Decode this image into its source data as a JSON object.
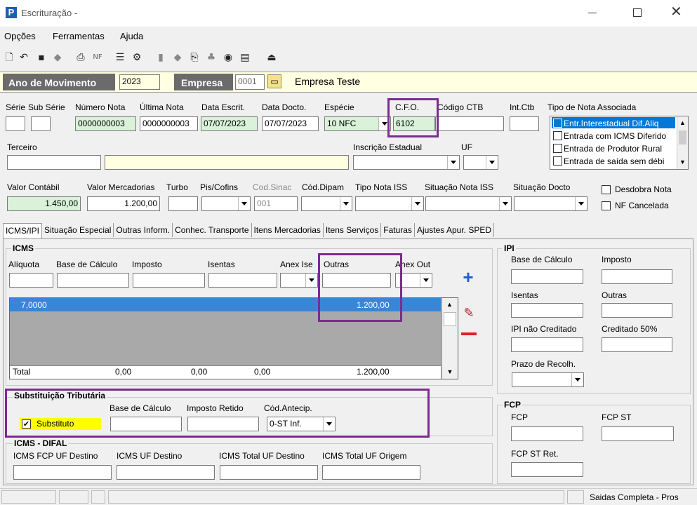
{
  "window": {
    "title": "Escrituração -",
    "app_icon": "P"
  },
  "menu": [
    "Opções",
    "Ferramentas",
    "Ajuda"
  ],
  "header": {
    "ano_label": "Ano de Movimento",
    "ano_value": "2023",
    "empresa_label": "Empresa",
    "empresa_code": "0001",
    "empresa_name": "Empresa Teste"
  },
  "nota": {
    "labels": {
      "serie": "Série",
      "subserie": "Sub Série",
      "numero": "Número Nota",
      "ultima": "Última Nota",
      "data_escrit": "Data Escrit.",
      "data_docto": "Data Docto.",
      "especie": "Espécie",
      "cfo": "C.F.O.",
      "codigo_ctb": "Código CTB",
      "int_ctb": "Int.Ctb",
      "tipo_nota": "Tipo de Nota Associada"
    },
    "numero": "0000000003",
    "ultima": "0000000003",
    "data_escrit": "07/07/2023",
    "data_docto": "07/07/2023",
    "especie": "10  NFC",
    "cfo": "6102",
    "tipo_nota_items": [
      "Entr.Interestadual Dif.Aliq",
      "Entrada com ICMS Diferido",
      "Entrada de Produtor Rural",
      "Entrada de saída sem débi"
    ]
  },
  "terceiro": {
    "label": "Terceiro",
    "ie_label": "Inscrição Estadual",
    "uf_label": "UF"
  },
  "valores": {
    "labels": {
      "contabil": "Valor Contábil",
      "mercadorias": "Valor Mercadorias",
      "turbo": "Turbo",
      "piscofins": "Pis/Cofins",
      "codsinac": "Cod.Sinac",
      "coddipam": "Cód.Dipam",
      "tiponotaiss": "Tipo Nota ISS",
      "situacaoiss": "Situação Nota ISS",
      "situacaodocto": "Situação Docto"
    },
    "contabil": "1.450,00",
    "mercadorias": "1.200,00",
    "codsinac": "001",
    "desdobra": "Desdobra Nota",
    "nf_cancelada": "NF Cancelada"
  },
  "tabs": [
    "ICMS/IPI",
    "Situação Especial",
    "Outras Inform.",
    "Conhec. Transporte",
    "Itens Mercadorias",
    "Itens Serviços",
    "Faturas",
    "Ajustes Apur. SPED"
  ],
  "icms": {
    "title": "ICMS",
    "cols": [
      "Alíquota",
      "Base de Cálculo",
      "Imposto",
      "Isentas",
      "Anex Ise",
      "Outras",
      "Anex Out"
    ],
    "row": {
      "aliquota": "7,0000",
      "outras": "1.200,00"
    },
    "total_label": "Total",
    "totals": [
      "0,00",
      "0,00",
      "0,00",
      "1.200,00"
    ]
  },
  "st": {
    "title": "Substituição Tributária",
    "base": "Base de Cálculo",
    "retido": "Imposto Retido",
    "antecip": "Cód.Antecip.",
    "substituto": "Substituto",
    "antecip_value": "0-ST Inf."
  },
  "difal": {
    "title": "ICMS - DIFAL",
    "fcp_dest": "ICMS FCP UF Destino",
    "uf_dest": "ICMS UF Destino",
    "total_dest": "ICMS Total UF Destino",
    "total_orig": "ICMS Total UF Origem"
  },
  "ipi": {
    "title": "IPI",
    "base": "Base de Cálculo",
    "imposto": "Imposto",
    "isentas": "Isentas",
    "outras": "Outras",
    "nao_cred": "IPI não Creditado",
    "cred50": "Creditado 50%",
    "prazo": "Prazo de Recolh."
  },
  "fcp": {
    "title": "FCP",
    "fcp": "FCP",
    "fcpst": "FCP ST",
    "fcpstret": "FCP ST Ret."
  },
  "status": {
    "text": "Saidas Completa - Pros"
  },
  "colors": {
    "header_bg": "#6b6b6b",
    "highlight": "#7b2c8f",
    "selected_row": "#3a86d4",
    "yellow_field": "#ffffe1",
    "green_field": "#d9f2d9",
    "substituto_bg": "#ffff00"
  }
}
